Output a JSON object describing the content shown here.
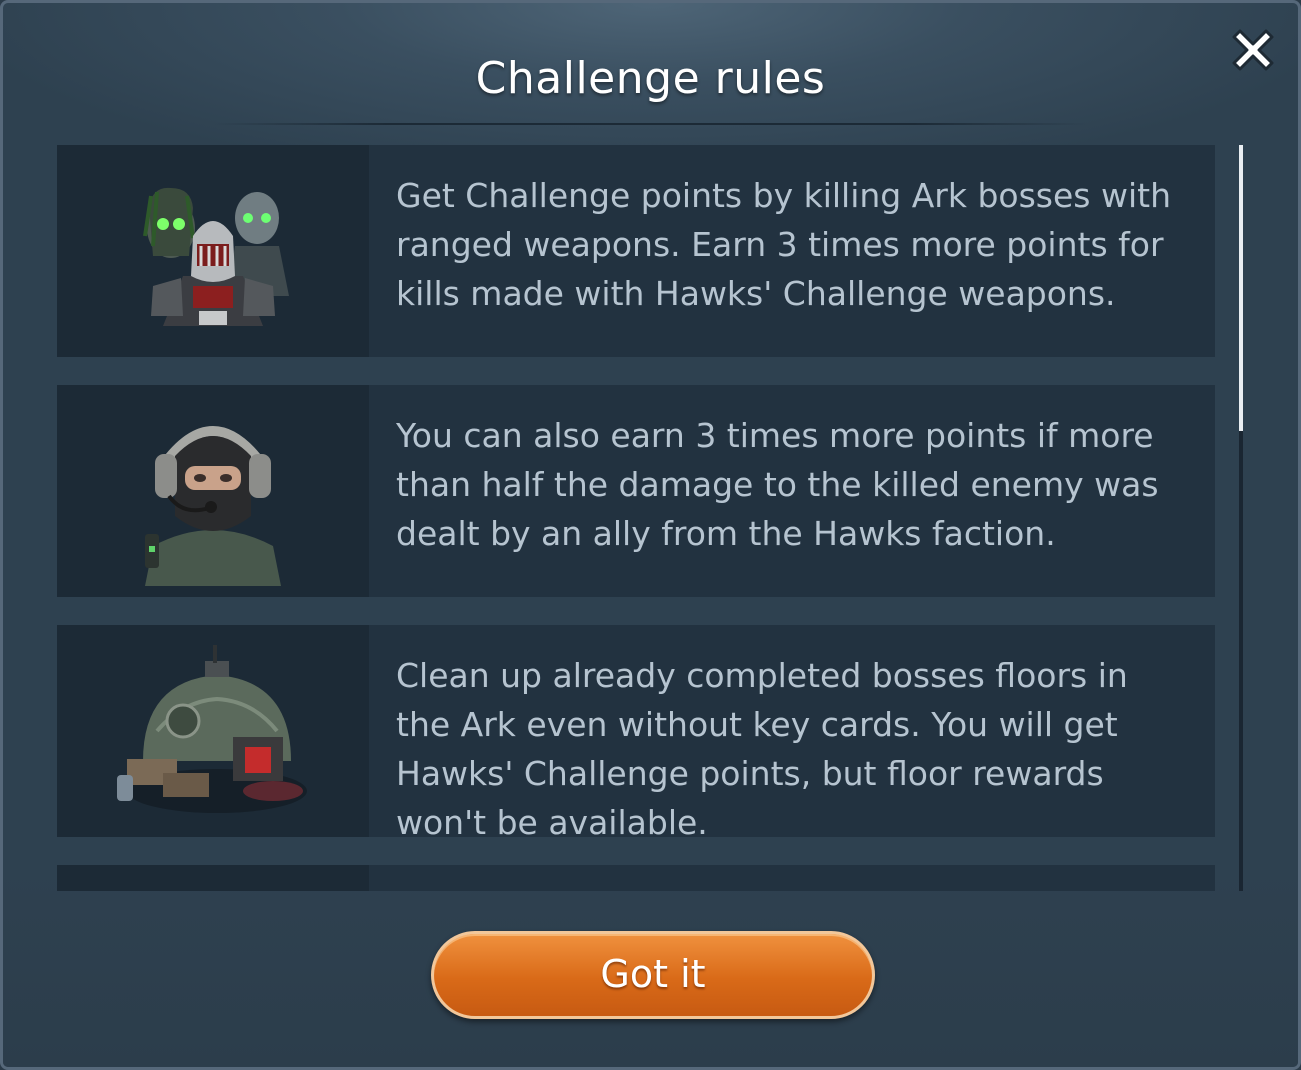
{
  "dialog": {
    "title": "Challenge rules",
    "close_icon": "close-icon",
    "confirm_label": "Got it"
  },
  "rules": [
    {
      "icon": "bosses-group-icon",
      "text": "Get Challenge points by killing Ark bosses with ranged weapons. Earn 3 times more points for kills made with Hawks' Challenge weapons."
    },
    {
      "icon": "hawks-soldier-icon",
      "text": "You can also earn 3 times more points if more than half the damage to the killed enemy was dealt by an ally from the Hawks faction."
    },
    {
      "icon": "ark-bunker-icon",
      "text": "Clean up already completed bosses floors in the Ark even without key cards. You will get Hawks' Challenge points, but floor rewards won't be available."
    },
    {
      "icon": "",
      "text": ""
    }
  ],
  "colors": {
    "panel_bg": "#2e4150",
    "card_bg": "#223240",
    "thumb_bg": "#1c2a36",
    "text": "#b6c4d0",
    "button": "#d96a18"
  }
}
